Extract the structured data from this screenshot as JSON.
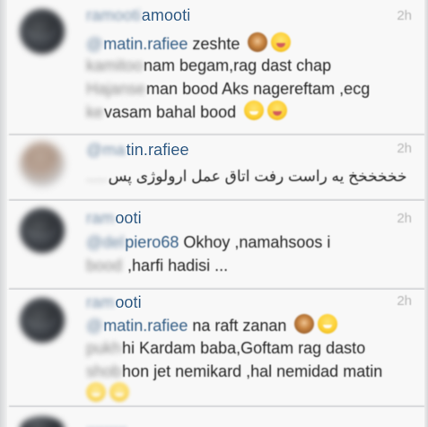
{
  "comments": [
    {
      "username_blur": "ramooti",
      "username": "amooti",
      "time": "2h",
      "lines": [
        {
          "mention_blur": "@",
          "mention": "matin.rafiee",
          "text": " zeshte",
          "emojis": [
            "see-no-evil-monkey-emoji",
            "squinting-tongue-face-emoji"
          ]
        },
        {
          "prefix_blur": "kamitoo",
          "text": "nam begam,rag dast chap",
          "emojis": []
        },
        {
          "prefix_blur": "Hajanse",
          "text": "man bood Aks nagereftam ,ecg",
          "emojis": []
        },
        {
          "prefix_blur": "ke ",
          "text": "vasam bahal bood",
          "emojis": [
            "grinning-face-emoji",
            "squinting-tongue-face-emoji"
          ]
        }
      ]
    },
    {
      "username_blur": "@ma",
      "username": "tin.rafiee",
      "time": "2h",
      "lines": [
        {
          "text": "خخخخخخ یه راست رفت اتاق عمل ارولوژی پس",
          "prefix_blur": ".....",
          "emojis": []
        }
      ]
    },
    {
      "username_blur": "ram",
      "username": "ooti",
      "time": "2h",
      "lines": [
        {
          "mention_blur": "@del",
          "mention": "piero68",
          "text": " Okhoy ,namahsoos i",
          "emojis": []
        },
        {
          "prefix_blur": "bood",
          "text": " ,harfi hadisi ...",
          "emojis": []
        }
      ]
    },
    {
      "username_blur": "ram",
      "username": "ooti",
      "time": "2h",
      "lines": [
        {
          "mention_blur": "@",
          "mention": "matin.rafiee",
          "text": " na raft zanan",
          "emojis": [
            "see-no-evil-monkey-emoji",
            "grinning-face-emoji"
          ]
        },
        {
          "prefix_blur": "pukh",
          "text": "hi Kardam baba,Goftam rag dasto",
          "emojis": []
        },
        {
          "prefix_blur": "shob",
          "text": "hon jet nemikard ,hal nemidad matin",
          "emojis": []
        },
        {
          "prefix_blur": "",
          "text": "",
          "emojis": [
            "grinning-face-emoji",
            "grinning-face-emoji"
          ]
        }
      ]
    }
  ],
  "colors": {
    "username": "#2f5b86",
    "timestamp": "#b7b7b7",
    "text": "#232323",
    "background": "#f7f7f7"
  }
}
